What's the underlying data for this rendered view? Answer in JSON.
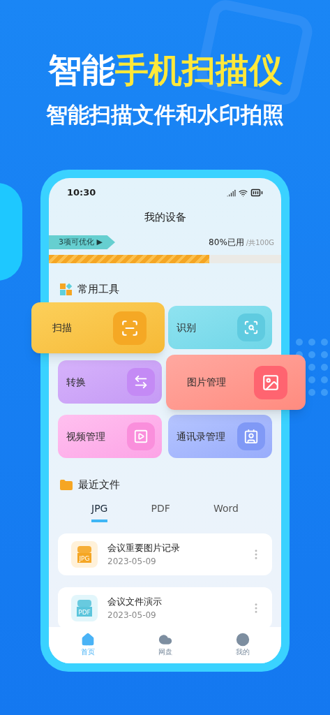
{
  "headline": [
    {
      "text": "智能",
      "highlight": false
    },
    {
      "text": "手机扫描仪",
      "highlight": true
    }
  ],
  "subtitle": "智能扫描文件和水印拍照",
  "phone": {
    "status_time": "10:30",
    "header": "我的设备",
    "storage": {
      "tag": "3项可优化 ▶",
      "used": "80%已用",
      "total": "/共100G",
      "level": 0.69
    },
    "tools_title": "常用工具",
    "tools": [
      {
        "label": "扫描",
        "kind": "scan",
        "featured": true
      },
      {
        "label": "识别",
        "kind": "recognize",
        "featured": false
      },
      {
        "label": "转换",
        "kind": "convert",
        "featured": false
      },
      {
        "label": "图片管理",
        "kind": "image",
        "featured": true
      },
      {
        "label": "视频管理",
        "kind": "video",
        "featured": false
      },
      {
        "label": "通讯录管理",
        "kind": "contacts",
        "featured": false
      }
    ],
    "recent_title": "最近文件",
    "tabs": [
      {
        "label": "JPG",
        "selected": true
      },
      {
        "label": "PDF",
        "selected": false
      },
      {
        "label": "Word",
        "selected": false
      }
    ],
    "files": [
      {
        "name": "会议重要图片记录",
        "date": "2023-05-09",
        "kind": "jpg",
        "badge": "JPG"
      },
      {
        "name": "会议文件演示",
        "date": "2023-05-09",
        "kind": "pdf",
        "badge": "PDF"
      }
    ],
    "nav": [
      {
        "label": "首页",
        "kind": "home",
        "selected": true
      },
      {
        "label": "网盘",
        "kind": "cloud",
        "selected": false
      },
      {
        "label": "我的",
        "kind": "profile",
        "selected": false
      }
    ]
  }
}
